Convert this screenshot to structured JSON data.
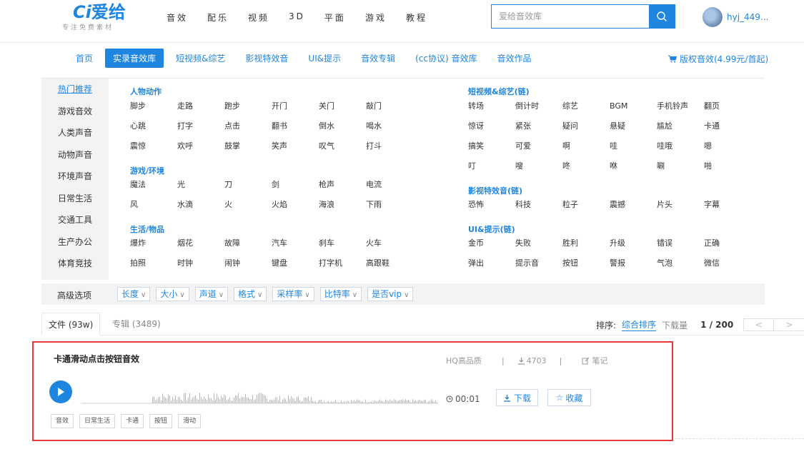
{
  "logo": {
    "mark_prefix": "Ci",
    "mark_text": "爱给",
    "tagline": "专注免费素材"
  },
  "main_nav": [
    "音效",
    "配乐",
    "视频",
    "3D",
    "平面",
    "游戏",
    "教程"
  ],
  "search": {
    "placeholder": "爱给音效库"
  },
  "user": {
    "name": "hyj_449..."
  },
  "sub_nav": [
    "首页",
    "实录音效库",
    "短视频&综艺",
    "影视特效音",
    "UI&提示",
    "音效专辑",
    "(cc协议) 音效库",
    "音效作品"
  ],
  "license_link": "版权音效(4.99元/首起)",
  "sidebar": [
    "热门推荐",
    "游戏音效",
    "人类声音",
    "动物声音",
    "环境声音",
    "日常生活",
    "交通工具",
    "生产办公",
    "体育竞技"
  ],
  "groups": {
    "human_action": {
      "title": "人物动作",
      "tags": [
        "脚步",
        "走路",
        "跑步",
        "开门",
        "关门",
        "敲门",
        "心跳",
        "打字",
        "点击",
        "翻书",
        "倒水",
        "喝水",
        "震惊",
        "欢呼",
        "鼓掌",
        "笑声",
        "叹气",
        "打斗"
      ]
    },
    "game_env": {
      "title": "游戏/环境",
      "tags": [
        "魔法",
        "光",
        "刀",
        "剑",
        "枪声",
        "电流",
        "风",
        "水滴",
        "火",
        "火焰",
        "海浪",
        "下雨"
      ]
    },
    "life_items": {
      "title": "生活/物品",
      "tags": [
        "爆炸",
        "烟花",
        "故障",
        "汽车",
        "刹车",
        "火车",
        "拍照",
        "时钟",
        "闹钟",
        "键盘",
        "打字机",
        "高跟鞋"
      ]
    },
    "short_video": {
      "title": "短视频&综艺(链)",
      "tags": [
        "转场",
        "倒计时",
        "综艺",
        "BGM",
        "手机铃声",
        "翻页",
        "惊讶",
        "紧张",
        "疑问",
        "悬疑",
        "尴尬",
        "卡通",
        "搞笑",
        "可爱",
        "啊",
        "哇",
        "哇哦",
        "嗯",
        "叮",
        "嗖",
        "咚",
        "咻",
        "唰",
        "啪"
      ]
    },
    "film_fx": {
      "title": "影视特效音(链)",
      "tags": [
        "恐怖",
        "科技",
        "粒子",
        "震撼",
        "片头",
        "字幕"
      ]
    },
    "ui_hint": {
      "title": "UI&提示(链)",
      "tags": [
        "金币",
        "失败",
        "胜利",
        "升级",
        "错误",
        "正确",
        "弹出",
        "提示音",
        "按钮",
        "警报",
        "气泡",
        "微信"
      ]
    }
  },
  "advanced": {
    "label": "高级选项",
    "filters": [
      "长度",
      "大小",
      "声道",
      "格式",
      "采样率",
      "比特率",
      "是否vip"
    ]
  },
  "tabs": {
    "files": "文件 (93w)",
    "albums": "专辑 (3489)"
  },
  "sort": {
    "label": "排序:",
    "option_active": "综合排序",
    "option_other": "下载量",
    "page": "1 / 200",
    "prev": "<",
    "next": ">"
  },
  "result": {
    "title": "卡通滑动点击按钮音效",
    "quality": "HQ高品质",
    "sep": "|",
    "downloads": "4703",
    "note": "笔记",
    "duration": "00:01",
    "download_btn": "下载",
    "favorite_btn": "收藏",
    "tags": [
      "音效",
      "日常生活",
      "卡通",
      "按钮",
      "滑动"
    ]
  },
  "colors": {
    "accent": "#1f86e0",
    "highlight_border": "#e53935"
  }
}
